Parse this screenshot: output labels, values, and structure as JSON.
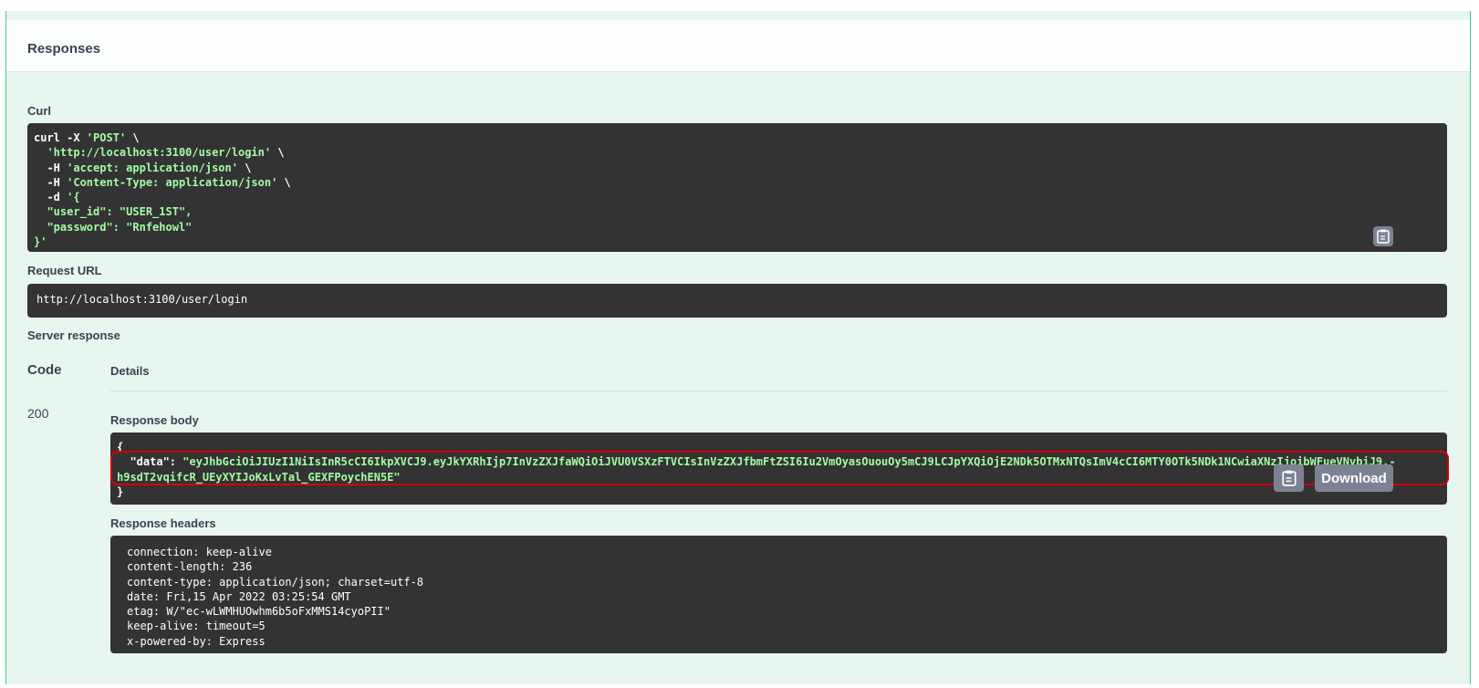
{
  "responses": {
    "title": "Responses"
  },
  "curl": {
    "label": "Curl",
    "lines": [
      [
        {
          "t": "curl -X ",
          "c": "w"
        },
        {
          "t": "'POST'",
          "c": "s"
        },
        {
          "t": " \\",
          "c": "w"
        }
      ],
      [
        {
          "t": "  ",
          "c": "w"
        },
        {
          "t": "'http://localhost:3100/user/login'",
          "c": "s"
        },
        {
          "t": " \\",
          "c": "w"
        }
      ],
      [
        {
          "t": "  -H ",
          "c": "w"
        },
        {
          "t": "'accept: application/json'",
          "c": "s"
        },
        {
          "t": " \\",
          "c": "w"
        }
      ],
      [
        {
          "t": "  -H ",
          "c": "w"
        },
        {
          "t": "'Content-Type: application/json'",
          "c": "s"
        },
        {
          "t": " \\",
          "c": "w"
        }
      ],
      [
        {
          "t": "  -d ",
          "c": "w"
        },
        {
          "t": "'{",
          "c": "s"
        }
      ],
      [
        {
          "t": "  \"user_id\": \"USER_1ST\",",
          "c": "s"
        }
      ],
      [
        {
          "t": "  \"password\": \"Rnfehowl\"",
          "c": "s"
        }
      ],
      [
        {
          "t": "}'",
          "c": "s"
        }
      ]
    ]
  },
  "request_url": {
    "label": "Request URL",
    "value": "http://localhost:3100/user/login"
  },
  "server_response": {
    "label": "Server response",
    "code_header": "Code",
    "details_header": "Details",
    "code": "200",
    "body_label": "Response body",
    "body_open": "{",
    "body_key": "  \"data\": ",
    "body_value_line1": "\"eyJhbGciOiJIUzI1NiIsInR5cCI6IkpXVCJ9.eyJkYXRhIjp7InVzZXJfaWQiOiJVU0VSXzFTVCIsInVzZXJfbmFtZSI6Iu2VmOyasOuouOy5mCJ9LCJpYXQiOjE2NDk5OTMxNTQsImV4cCI6MTY0OTk5NDk1NCwiaXNzIjoibWFueVNvbiJ9.-",
    "body_value_line2": "h9sdT2vqifcR_UEyXYIJoKxLvTal_GEXFPoychEN5E\"",
    "body_close": "}",
    "download_label": "Download",
    "headers_label": "Response headers",
    "headers": [
      "connection: keep-alive",
      "content-length: 236",
      "content-type: application/json; charset=utf-8",
      "date: Fri,15 Apr 2022 03:25:54 GMT",
      "etag: W/\"ec-wLWMHUOwhm6b5oFxMMS14cyoPII\"",
      "keep-alive: timeout=5",
      "x-powered-by: Express"
    ]
  },
  "colors": {
    "accent": "#49cc90",
    "panel": "#333333",
    "string": "#a2fca2",
    "highlight": "#d40000"
  },
  "icons": {
    "copy": "clipboard-icon"
  }
}
